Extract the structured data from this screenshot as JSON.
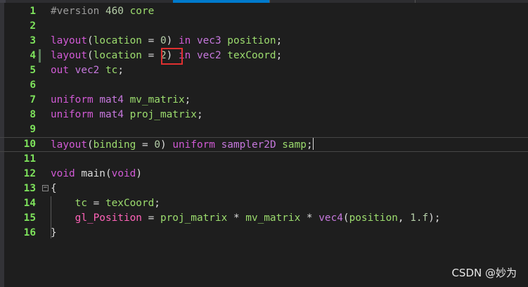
{
  "colors": {
    "background": "#1e1e1e",
    "line_number": "#7ee35c",
    "keyword": "#d15ad5",
    "identifier": "#9cdc6e",
    "number": "#b5cea8",
    "builtin": "#ff63b8",
    "highlight_box": "#e03030"
  },
  "lines": [
    {
      "num": "1",
      "parts": [
        {
          "c": "d",
          "t": "#version "
        },
        {
          "c": "n",
          "t": "460"
        },
        {
          "c": "v",
          "t": " core"
        }
      ]
    },
    {
      "num": "2",
      "parts": []
    },
    {
      "num": "3",
      "parts": [
        {
          "c": "k",
          "t": "layout"
        },
        {
          "c": "p",
          "t": "("
        },
        {
          "c": "v",
          "t": "location"
        },
        {
          "c": "p",
          "t": " = "
        },
        {
          "c": "n",
          "t": "0"
        },
        {
          "c": "p",
          "t": ") "
        },
        {
          "c": "k",
          "t": "in"
        },
        {
          "c": "t",
          "t": " vec3"
        },
        {
          "c": "v",
          "t": " position"
        },
        {
          "c": "p",
          "t": ";"
        }
      ]
    },
    {
      "num": "4",
      "parts": [
        {
          "c": "k",
          "t": "layout"
        },
        {
          "c": "p",
          "t": "("
        },
        {
          "c": "v",
          "t": "location"
        },
        {
          "c": "p",
          "t": " = "
        },
        {
          "c": "n",
          "t": "2"
        },
        {
          "c": "p",
          "t": ") "
        },
        {
          "c": "k",
          "t": "in"
        },
        {
          "c": "t",
          "t": " vec2"
        },
        {
          "c": "v",
          "t": " texCoord"
        },
        {
          "c": "p",
          "t": ";"
        }
      ]
    },
    {
      "num": "5",
      "parts": [
        {
          "c": "k",
          "t": "out"
        },
        {
          "c": "t",
          "t": " vec2"
        },
        {
          "c": "v",
          "t": " tc"
        },
        {
          "c": "p",
          "t": ";"
        }
      ]
    },
    {
      "num": "6",
      "parts": []
    },
    {
      "num": "7",
      "parts": [
        {
          "c": "k",
          "t": "uniform"
        },
        {
          "c": "t",
          "t": " mat4"
        },
        {
          "c": "v",
          "t": " mv_matrix"
        },
        {
          "c": "p",
          "t": ";"
        }
      ]
    },
    {
      "num": "8",
      "parts": [
        {
          "c": "k",
          "t": "uniform"
        },
        {
          "c": "t",
          "t": " mat4"
        },
        {
          "c": "v",
          "t": " proj_matrix"
        },
        {
          "c": "p",
          "t": ";"
        }
      ]
    },
    {
      "num": "9",
      "parts": []
    },
    {
      "num": "10",
      "parts": [
        {
          "c": "k",
          "t": "layout"
        },
        {
          "c": "p",
          "t": "("
        },
        {
          "c": "v",
          "t": "binding"
        },
        {
          "c": "p",
          "t": " = "
        },
        {
          "c": "n",
          "t": "0"
        },
        {
          "c": "p",
          "t": ") "
        },
        {
          "c": "k",
          "t": "uniform"
        },
        {
          "c": "t",
          "t": " sampler2D"
        },
        {
          "c": "v",
          "t": " samp"
        },
        {
          "c": "p",
          "t": ";"
        }
      ]
    },
    {
      "num": "11",
      "parts": []
    },
    {
      "num": "12",
      "parts": [
        {
          "c": "k",
          "t": "void"
        },
        {
          "c": "f",
          "t": " main"
        },
        {
          "c": "p",
          "t": "("
        },
        {
          "c": "k",
          "t": "void"
        },
        {
          "c": "p",
          "t": ")"
        }
      ]
    },
    {
      "num": "13",
      "parts": [
        {
          "c": "p",
          "t": "{"
        }
      ]
    },
    {
      "num": "14",
      "parts": [
        {
          "c": "p",
          "t": "    "
        },
        {
          "c": "v",
          "t": "tc"
        },
        {
          "c": "p",
          "t": " = "
        },
        {
          "c": "v",
          "t": "texCoord"
        },
        {
          "c": "p",
          "t": ";"
        }
      ]
    },
    {
      "num": "15",
      "parts": [
        {
          "c": "p",
          "t": "    "
        },
        {
          "c": "b",
          "t": "gl_Position"
        },
        {
          "c": "p",
          "t": " = "
        },
        {
          "c": "v",
          "t": "proj_matrix"
        },
        {
          "c": "p",
          "t": " * "
        },
        {
          "c": "v",
          "t": "mv_matrix"
        },
        {
          "c": "p",
          "t": " * "
        },
        {
          "c": "t",
          "t": "vec4"
        },
        {
          "c": "p",
          "t": "("
        },
        {
          "c": "v",
          "t": "position"
        },
        {
          "c": "p",
          "t": ", "
        },
        {
          "c": "n",
          "t": "1.f"
        },
        {
          "c": "p",
          "t": ");"
        }
      ]
    },
    {
      "num": "16",
      "parts": [
        {
          "c": "p",
          "t": "}"
        }
      ]
    }
  ],
  "watermark": "CSDN @妙为"
}
